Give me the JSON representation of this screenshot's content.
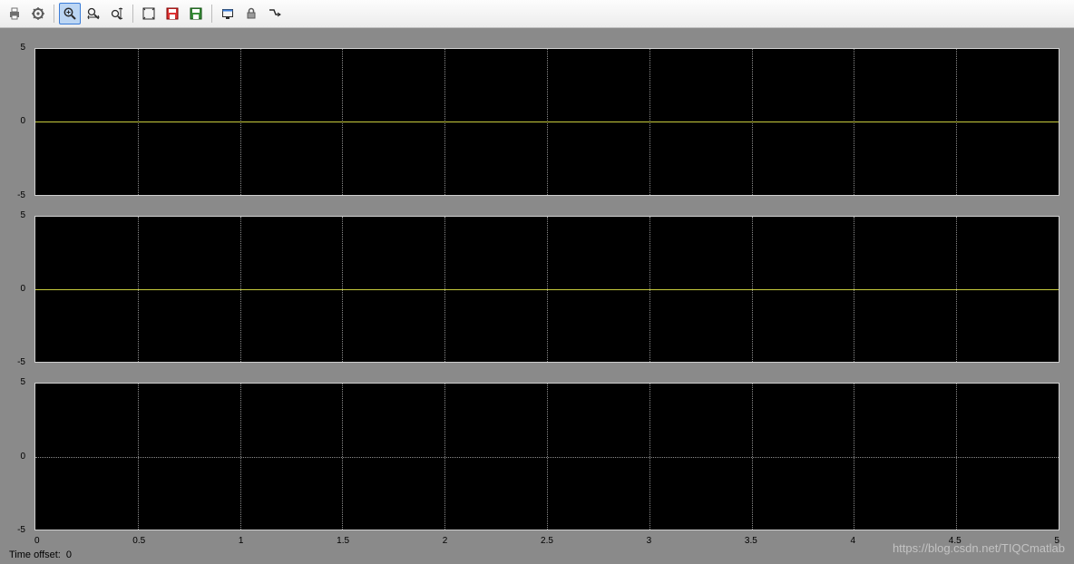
{
  "toolbar": {
    "buttons": [
      {
        "name": "print-icon",
        "sep": false
      },
      {
        "name": "parameters-icon",
        "sep": false
      },
      {
        "name": "sep"
      },
      {
        "name": "zoom-icon",
        "active": true
      },
      {
        "name": "zoom-x-icon"
      },
      {
        "name": "zoom-y-icon"
      },
      {
        "name": "sep"
      },
      {
        "name": "autoscale-icon"
      },
      {
        "name": "save-axes-icon"
      },
      {
        "name": "restore-axes-icon"
      },
      {
        "name": "sep"
      },
      {
        "name": "floating-scope-icon"
      },
      {
        "name": "lock-icon"
      },
      {
        "name": "signal-selection-icon"
      }
    ]
  },
  "chart_data": [
    {
      "type": "line",
      "x_range": [
        0,
        5
      ],
      "y_range": [
        -5,
        5
      ],
      "y_ticks": [
        -5,
        0,
        5
      ],
      "signal_y": 0,
      "has_signal": true,
      "grid_x": [
        0.5,
        1,
        1.5,
        2,
        2.5,
        3,
        3.5,
        4,
        4.5
      ],
      "grid_y": [
        0
      ]
    },
    {
      "type": "line",
      "x_range": [
        0,
        5
      ],
      "y_range": [
        -5,
        5
      ],
      "y_ticks": [
        -5,
        0,
        5
      ],
      "signal_y": 0,
      "has_signal": true,
      "grid_x": [
        0.5,
        1,
        1.5,
        2,
        2.5,
        3,
        3.5,
        4,
        4.5
      ],
      "grid_y": [
        0
      ]
    },
    {
      "type": "line",
      "x_range": [
        0,
        5
      ],
      "y_range": [
        -5,
        5
      ],
      "y_ticks": [
        -5,
        0,
        5
      ],
      "has_signal": false,
      "grid_x": [
        0.5,
        1,
        1.5,
        2,
        2.5,
        3,
        3.5,
        4,
        4.5
      ],
      "grid_y": [
        0
      ]
    }
  ],
  "x_ticks": [
    "0",
    "0.5",
    "1",
    "1.5",
    "2",
    "2.5",
    "3",
    "3.5",
    "4",
    "4.5",
    "5"
  ],
  "status": {
    "label": "Time offset:",
    "value": "0"
  },
  "watermark": "https://blog.csdn.net/TIQCmatlab"
}
